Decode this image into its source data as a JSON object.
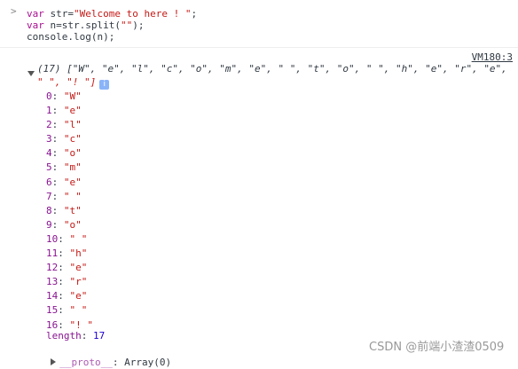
{
  "input": {
    "line1_kw": "var",
    "line1_rest": " str=",
    "line1_str": "\"Welcome to here ! \"",
    "line1_end": ";",
    "line2_kw": "var",
    "line2_rest": " n=str.split(",
    "line2_str": "\"\"",
    "line2_end": ");",
    "line3": "console.log(n);"
  },
  "source_link": "VM180:3",
  "summary": {
    "count_label": "(17) [",
    "elements_line1": [
      "\"W\"",
      "\"e\"",
      "\"l\"",
      "\"c\"",
      "\"o\"",
      "\"m\"",
      "\"e\"",
      "\" \"",
      "\"t\"",
      "\"o\"",
      "\" \"",
      "\"h\"",
      "\"e\"",
      "\"r\"",
      "\"e\","
    ],
    "line1_text": "(17) [\"W\", \"e\", \"l\", \"c\", \"o\", \"m\", \"e\", \" \", \"t\", \"o\", \" \", \"h\", \"e\", \"r\", \"e\",",
    "line2_text": "\" \", \"! \"]",
    "info_icon": "i"
  },
  "entries": [
    {
      "index": "0",
      "value": "\"W\""
    },
    {
      "index": "1",
      "value": "\"e\""
    },
    {
      "index": "2",
      "value": "\"l\""
    },
    {
      "index": "3",
      "value": "\"c\""
    },
    {
      "index": "4",
      "value": "\"o\""
    },
    {
      "index": "5",
      "value": "\"m\""
    },
    {
      "index": "6",
      "value": "\"e\""
    },
    {
      "index": "7",
      "value": "\" \""
    },
    {
      "index": "8",
      "value": "\"t\""
    },
    {
      "index": "9",
      "value": "\"o\""
    },
    {
      "index": "10",
      "value": "\" \""
    },
    {
      "index": "11",
      "value": "\"h\""
    },
    {
      "index": "12",
      "value": "\"e\""
    },
    {
      "index": "13",
      "value": "\"r\""
    },
    {
      "index": "14",
      "value": "\"e\""
    },
    {
      "index": "15",
      "value": "\" \""
    },
    {
      "index": "16",
      "value": "\"! \""
    }
  ],
  "length": {
    "key": "length",
    "value": "17"
  },
  "proto": {
    "key": "__proto__",
    "value": "Array(0)"
  },
  "watermark": "CSDN @前端小渣渣0509"
}
